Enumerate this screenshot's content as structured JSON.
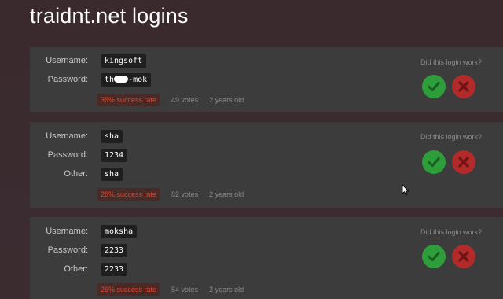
{
  "page": {
    "title": "traidnt.net logins"
  },
  "question_label": "Did this login work?",
  "logins": [
    {
      "fields": [
        {
          "label": "Username:",
          "value": "kingsoft"
        },
        {
          "label": "Password:",
          "value_start": "th",
          "value_end": "-mok",
          "redacted": true
        }
      ],
      "success_rate": "35% success rate",
      "votes": "49 votes",
      "age": "2 years old"
    },
    {
      "fields": [
        {
          "label": "Username:",
          "value": "sha"
        },
        {
          "label": "Password:",
          "value": "1234"
        },
        {
          "label": "Other:",
          "value": "sha"
        }
      ],
      "success_rate": "26% success rate",
      "votes": "82 votes",
      "age": "2 years old"
    },
    {
      "fields": [
        {
          "label": "Username:",
          "value": "moksha"
        },
        {
          "label": "Password:",
          "value": "2233"
        },
        {
          "label": "Other:",
          "value": "2233"
        }
      ],
      "success_rate": "26% success rate",
      "votes": "54 votes",
      "age": "2 years old"
    }
  ],
  "colors": {
    "yes": "#2e9e3a",
    "no": "#b22a2a",
    "rate_text": "#e0472e"
  },
  "icons": {
    "yes": "checkmark-icon",
    "no": "x-mark-icon",
    "cursor": "mouse-pointer-icon"
  }
}
